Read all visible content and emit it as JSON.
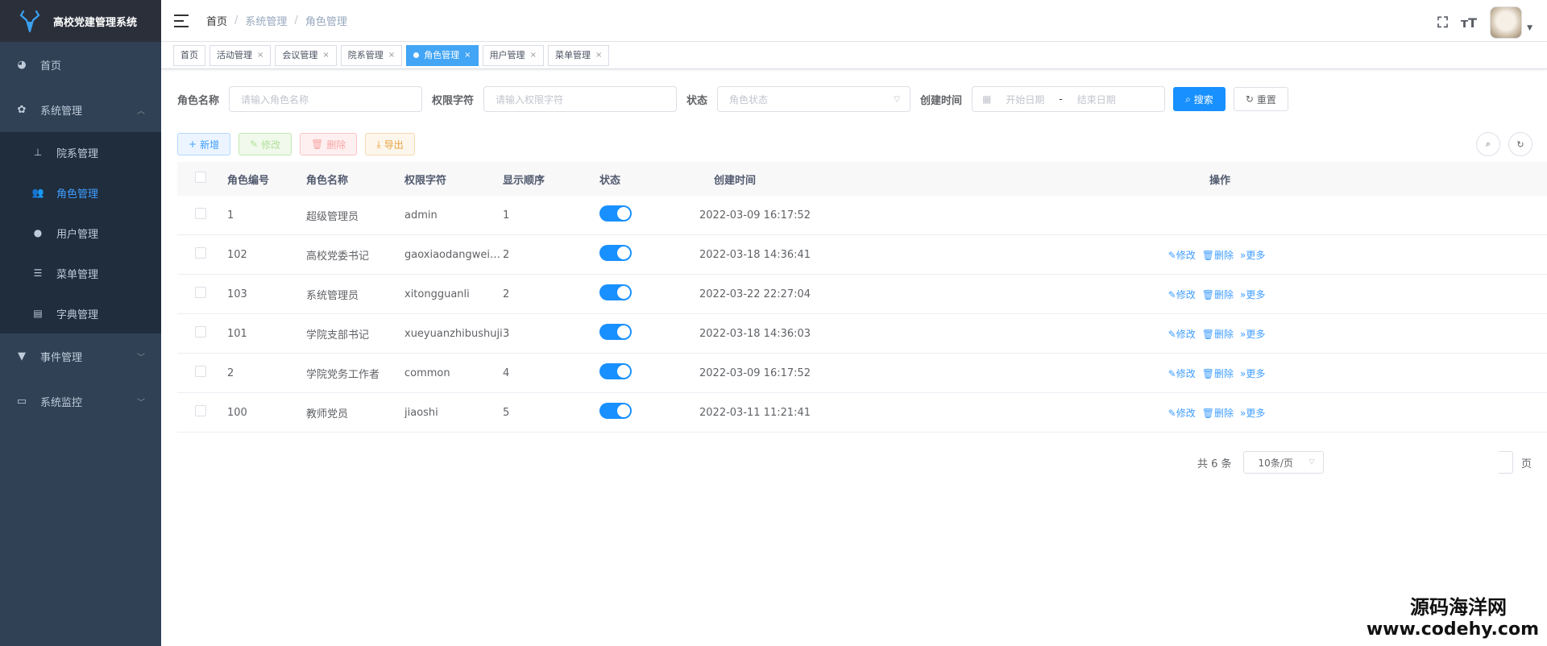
{
  "app": {
    "title": "高校党建管理系统"
  },
  "sidebar": {
    "items": [
      {
        "label": "首页",
        "icon": "dashboard-icon"
      },
      {
        "label": "系统管理",
        "icon": "gear-icon",
        "expanded": true,
        "children": [
          {
            "label": "院系管理",
            "icon": "tree-icon"
          },
          {
            "label": "角色管理",
            "icon": "peoples-icon",
            "active": true
          },
          {
            "label": "用户管理",
            "icon": "user-icon"
          },
          {
            "label": "菜单管理",
            "icon": "tree-table-icon"
          },
          {
            "label": "字典管理",
            "icon": "dict-icon"
          }
        ]
      },
      {
        "label": "事件管理",
        "icon": "shirt-icon"
      },
      {
        "label": "系统监控",
        "icon": "monitor-icon"
      }
    ]
  },
  "breadcrumb": [
    "首页",
    "系统管理",
    "角色管理"
  ],
  "tags": [
    {
      "label": "首页",
      "closable": false
    },
    {
      "label": "活动管理",
      "closable": true
    },
    {
      "label": "会议管理",
      "closable": true
    },
    {
      "label": "院系管理",
      "closable": true
    },
    {
      "label": "角色管理",
      "closable": true,
      "active": true
    },
    {
      "label": "用户管理",
      "closable": true
    },
    {
      "label": "菜单管理",
      "closable": true
    }
  ],
  "search": {
    "role_name_label": "角色名称",
    "role_name_placeholder": "请输入角色名称",
    "role_key_label": "权限字符",
    "role_key_placeholder": "请输入权限字符",
    "status_label": "状态",
    "status_placeholder": "角色状态",
    "created_label": "创建时间",
    "start_placeholder": "开始日期",
    "range_sep": "-",
    "end_placeholder": "结束日期",
    "search_button": "搜索",
    "reset_button": "重置"
  },
  "toolbar": {
    "add": "新增",
    "edit": "修改",
    "delete": "删除",
    "export": "导出"
  },
  "table": {
    "columns": [
      "角色编号",
      "角色名称",
      "权限字符",
      "显示顺序",
      "状态",
      "创建时间",
      "操作"
    ],
    "rows": [
      {
        "id": "1",
        "name": "超级管理员",
        "key": "admin",
        "order": "1",
        "enabled": true,
        "created": "2022-03-09 16:17:52",
        "actions": []
      },
      {
        "id": "102",
        "name": "高校党委书记",
        "key": "gaoxiaodangweish...",
        "order": "2",
        "enabled": true,
        "created": "2022-03-18 14:36:41",
        "actions": [
          "修改",
          "删除",
          "更多"
        ]
      },
      {
        "id": "103",
        "name": "系统管理员",
        "key": "xitongguanli",
        "order": "2",
        "enabled": true,
        "created": "2022-03-22 22:27:04",
        "actions": [
          "修改",
          "删除",
          "更多"
        ]
      },
      {
        "id": "101",
        "name": "学院支部书记",
        "key": "xueyuanzhibushuji",
        "order": "3",
        "enabled": true,
        "created": "2022-03-18 14:36:03",
        "actions": [
          "修改",
          "删除",
          "更多"
        ]
      },
      {
        "id": "2",
        "name": "学院党务工作者",
        "key": "common",
        "order": "4",
        "enabled": true,
        "created": "2022-03-09 16:17:52",
        "actions": [
          "修改",
          "删除",
          "更多"
        ]
      },
      {
        "id": "100",
        "name": "教师党员",
        "key": "jiaoshi",
        "order": "5",
        "enabled": true,
        "created": "2022-03-11 11:21:41",
        "actions": [
          "修改",
          "删除",
          "更多"
        ]
      }
    ]
  },
  "pagination": {
    "total": "共 6 条",
    "page_size": "10条/页",
    "page_suffix": "页"
  },
  "watermark": {
    "line1": "源码海洋网",
    "line2": "www.codehy.com"
  },
  "colors": {
    "sidebar_bg": "#304156",
    "primary": "#1890ff",
    "active_menu": "#409eff"
  }
}
